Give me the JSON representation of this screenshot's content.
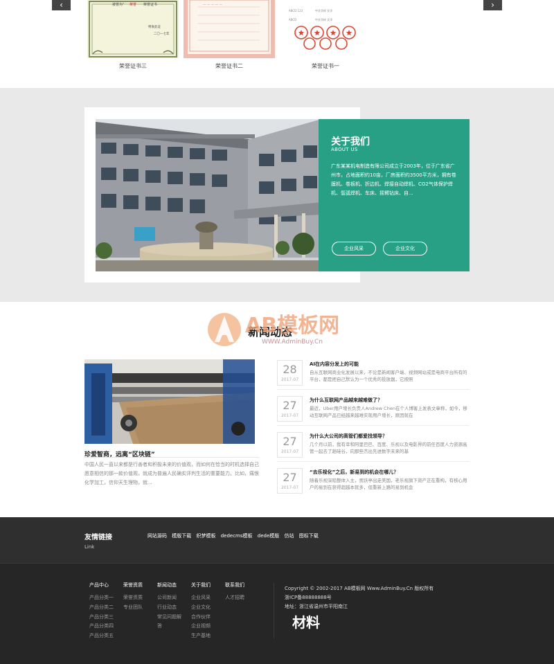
{
  "honor": {
    "prev_arrow": "‹",
    "next_arrow": "›",
    "certificates": [
      {
        "caption": "荣誉证书三",
        "style": "green-ornate"
      },
      {
        "caption": "荣誉证书二",
        "style": "pink-border"
      },
      {
        "caption": "荣誉证书一",
        "style": "red-seals"
      }
    ],
    "cert1_text": [
      "被誉为    荣誉证书",
      "特发此证",
      "二〇一七年"
    ]
  },
  "about": {
    "title": "关于我们",
    "subtitle": "ABOUT US",
    "text": "广东某某机电制造有限公司成立于2003年，位于广东省广州市，占地面积约10亩，厂房面积约3500平方米，拥有卷膜机、卷板机、折边机、焊接自动焊机、CO2气体保护焊机、氩弧焊机、车床、摇臂钻床、自...",
    "button_1": "企业风采",
    "button_2": "企业文化",
    "accent": "#27a085"
  },
  "news": {
    "title": "新闻动态",
    "feature": {
      "title": "珍爱智商，远离“区块链”",
      "text": "中国人民一直以来都是行善者和积极未来的价值观，而如何在恰当的时机选择自己愿意相信的那一款价值观，就成为普遍人民确实评判生活的重要能力。比如，痛恨化学加工，信仰天生理物，就..."
    },
    "items": [
      {
        "day": "28",
        "ym": "2017-07",
        "title": "AI在内容分发上的可能",
        "text": "自从互联网商业化发展以来，不论是新闻客户端、视频网站或是电商平台所有的平台，都是把自己默认为一个优秀的投放器，它按照"
      },
      {
        "day": "27",
        "ym": "2017-07",
        "title": "为什么互联网产品越来越难做了？",
        "text": "最近，Uber用户增长负责人Andrew Chen在个人博客上发表文章称，如今，移动互联网产品已经越来越难实现用户增长，原因就在"
      },
      {
        "day": "27",
        "ym": "2017-07",
        "title": "为什么大公司的高管们都爱找领导？",
        "text": "几个月以前，我有幸和阿里巴巴、百度、乐视以及电影界的前任百度人力资源高管一起去了趟硅谷，向那些杰出先进数字未来的基"
      },
      {
        "day": "27",
        "ym": "2017-07",
        "title": "“去乐视化”之后，新易到的机会在哪儿？",
        "text": "随着乐视深陷整体入主，贾跃亭出走美国，老乐视旗下资产正在重构，有核心用户的易到在获得超越本就多，但重新上路的易到机会"
      }
    ]
  },
  "watermark": {
    "text": "AB模板网",
    "url": "WWW.AdminBuy.Cn"
  },
  "friend_links": {
    "title": "友情链接",
    "subtitle": "Link",
    "links": [
      "网站源码",
      "模版下载",
      "织梦模板",
      "dedecms模板",
      "dede模版",
      "仿站",
      "图标下载"
    ]
  },
  "footer": {
    "columns": [
      {
        "heading": "产品中心",
        "items": [
          "产品分类一",
          "产品分类二",
          "产品分类三",
          "产品分类四",
          "产品分类五"
        ]
      },
      {
        "heading": "荣誉资质",
        "items": [
          "荣誉资质",
          "专业团队"
        ]
      },
      {
        "heading": "新闻动态",
        "items": [
          "公司新闻",
          "行业动态",
          "常见问题解",
          "答"
        ]
      },
      {
        "heading": "关于我们",
        "items": [
          "企业风采",
          "企业文化",
          "合作伙伴",
          "企业视频",
          "生产基地"
        ]
      },
      {
        "heading": "联系我们",
        "items": [
          "人才招聘"
        ]
      }
    ],
    "copyright": "Copyright © 2002-2017 AB模板网 Www.AdminBuy.Cn 版权所有",
    "icp": "浙ICP备88888888号",
    "address": "地址：浙江省温州市平阳南江",
    "signature": "材料"
  }
}
